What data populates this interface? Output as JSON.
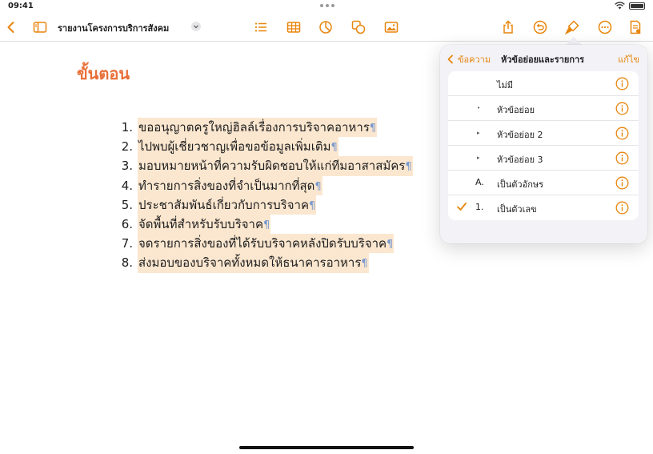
{
  "status_bar": {
    "time": "09:41"
  },
  "toolbar": {
    "document_title": "รายงานโครงการบริการสังคม",
    "icons": [
      "back-chevron-icon",
      "sidebar-icon",
      "list-icon",
      "table-icon",
      "chart-icon",
      "shapes-icon",
      "media-icon",
      "share-icon",
      "undo-icon",
      "format-brush-icon",
      "more-icon",
      "document-options-icon"
    ],
    "accent_color": "#e8850c"
  },
  "document": {
    "heading": "ขั้นตอน",
    "heading_color": "#e8703a",
    "pilcrow": "¶",
    "items": [
      {
        "number": "1.",
        "text": "ขออนุญาตครูใหญ่ฮิลล์เรื่องการบริจาคอาหาร"
      },
      {
        "number": "2.",
        "text": "ไปพบผู้เชี่ยวชาญเพื่อขอข้อมูลเพิ่มเติม"
      },
      {
        "number": "3.",
        "text": "มอบหมายหน้าที่ความรับผิดชอบให้แก่ทีมอาสาสมัคร"
      },
      {
        "number": "4.",
        "text": "ทำรายการสิ่งของที่จำเป็นมากที่สุด"
      },
      {
        "number": "5.",
        "text": "ประชาสัมพันธ์เกี่ยวกับการบริจาค"
      },
      {
        "number": "6.",
        "text": "จัดพื้นที่สำหรับรับบริจาค"
      },
      {
        "number": "7.",
        "text": "จดรายการสิ่งของที่ได้รับบริจาคหลังปิดรับบริจาค"
      },
      {
        "number": "8.",
        "text": "ส่งมอบของบริจาคทั้งหมดให้ธนาคารอาหาร"
      }
    ]
  },
  "popover": {
    "back_label": "ข้อความ",
    "title": "หัวข้อย่อยและรายการ",
    "edit_label": "แก้ไข",
    "options": [
      {
        "marker": "",
        "label": "ไม่มี",
        "selected": false
      },
      {
        "marker": "•",
        "label": "หัวข้อย่อย",
        "selected": false
      },
      {
        "marker": "▸",
        "label": "หัวข้อย่อย 2",
        "selected": false
      },
      {
        "marker": "▸",
        "label": "หัวข้อย่อย 3",
        "selected": false
      },
      {
        "marker": "A.",
        "label": "เป็นตัวอักษร",
        "selected": false
      },
      {
        "marker": "1.",
        "label": "เป็นตัวเลข",
        "selected": true
      }
    ]
  }
}
